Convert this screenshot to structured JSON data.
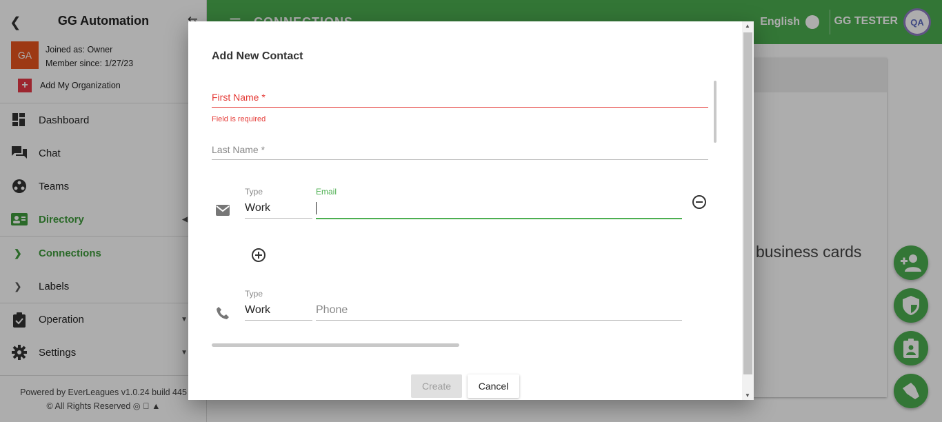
{
  "sidebar": {
    "org_title": "GG Automation",
    "avatar_initials": "GA",
    "joined_as": "Joined as: Owner",
    "member_since": "Member since: 1/27/23",
    "add_org": "Add My Organization",
    "nav": [
      {
        "label": "Dashboard",
        "icon": "dashboard-icon"
      },
      {
        "label": "Chat",
        "icon": "chat-icon"
      },
      {
        "label": "Teams",
        "icon": "teams-icon"
      },
      {
        "label": "Directory",
        "icon": "directory-icon",
        "active": true
      }
    ],
    "sub_nav": [
      {
        "label": "Connections",
        "current": true
      },
      {
        "label": "Labels"
      }
    ],
    "nav_bottom": [
      {
        "label": "Operation",
        "icon": "operation-icon"
      },
      {
        "label": "Settings",
        "icon": "settings-icon"
      }
    ],
    "footer_line1": "Powered by EverLeagues v1.0.24 build 445",
    "footer_line2": "© All Rights Reserved"
  },
  "topbar": {
    "title": "CONNECTIONS",
    "language": "English",
    "user": "GG TESTER",
    "user_avatar": "QA"
  },
  "main": {
    "visible_text": "business cards"
  },
  "dialog": {
    "title": "Add New Contact",
    "first_name_label": "First Name *",
    "first_name_error": "Field is required",
    "last_name_label": "Last Name *",
    "email_type_label": "Type",
    "email_type_value": "Work",
    "email_label": "Email",
    "email_value": "",
    "phone_type_label": "Type",
    "phone_type_value": "Work",
    "phone_placeholder": "Phone",
    "create_label": "Create",
    "cancel_label": "Cancel"
  },
  "colors": {
    "brand_green": "#4caf50",
    "error_red": "#e53935",
    "avatar_orange": "#e8541e"
  }
}
